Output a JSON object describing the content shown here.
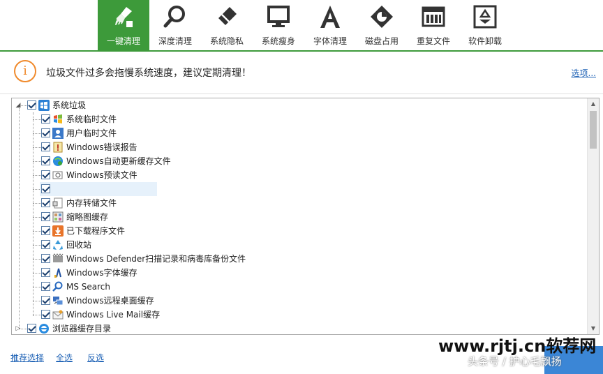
{
  "toolbar": {
    "tabs": [
      {
        "label": "一键清理",
        "icon": "broom-icon",
        "active": true
      },
      {
        "label": "深度清理",
        "icon": "magnifier-icon",
        "active": false
      },
      {
        "label": "系统隐私",
        "icon": "eraser-icon",
        "active": false
      },
      {
        "label": "系统瘦身",
        "icon": "monitor-icon",
        "active": false
      },
      {
        "label": "字体清理",
        "icon": "letter-a-icon",
        "active": false
      },
      {
        "label": "磁盘占用",
        "icon": "disk-pie-icon",
        "active": false
      },
      {
        "label": "重复文件",
        "icon": "duplicate-files-icon",
        "active": false
      },
      {
        "label": "软件卸载",
        "icon": "recycle-box-icon",
        "active": false
      }
    ],
    "accent": "#3d9a3a"
  },
  "info": {
    "icon": "info-warning-icon",
    "icon_glyph": "i",
    "message": "垃圾文件过多会拖慢系统速度，建议定期清理！",
    "options_link": "选项..."
  },
  "tree": {
    "root": {
      "label": "系统垃圾",
      "icon": "windows-logo-icon",
      "checked": true,
      "expanded": true
    },
    "items": [
      {
        "label": "系统临时文件",
        "icon": "windows-flag-icon",
        "checked": true
      },
      {
        "label": "用户临时文件",
        "icon": "user-icon",
        "checked": true
      },
      {
        "label": "Windows错误报告",
        "icon": "error-report-icon",
        "checked": true
      },
      {
        "label": "Windows自动更新缓存文件",
        "icon": "windows-update-icon",
        "checked": true
      },
      {
        "label": "Windows预读文件",
        "icon": "prefetch-icon",
        "checked": true
      },
      {
        "label": "",
        "icon": "",
        "checked": true,
        "selected": true
      },
      {
        "label": "内存转储文件",
        "icon": "memory-dump-icon",
        "checked": true
      },
      {
        "label": "缩略图缓存",
        "icon": "thumbnail-icon",
        "checked": true
      },
      {
        "label": "已下载程序文件",
        "icon": "download-icon",
        "checked": true
      },
      {
        "label": "回收站",
        "icon": "recycle-bin-icon",
        "checked": true
      },
      {
        "label": "Windows Defender扫描记录和病毒库备份文件",
        "icon": "defender-icon",
        "checked": true
      },
      {
        "label": "Windows字体缓存",
        "icon": "font-cache-icon",
        "checked": true
      },
      {
        "label": "MS Search",
        "icon": "search-icon",
        "checked": true
      },
      {
        "label": "Windows远程桌面缓存",
        "icon": "remote-desktop-icon",
        "checked": true
      },
      {
        "label": "Windows Live Mail缓存",
        "icon": "live-mail-icon",
        "checked": true
      }
    ],
    "second_root": {
      "label": "浏览器缓存目录",
      "icon": "ie-icon",
      "checked": true,
      "expanded": false
    }
  },
  "footer": {
    "recommend": "推荐选择",
    "select_all": "全选",
    "invert": "反选"
  },
  "watermark": {
    "site": "www.rjtj.cn软荐网",
    "credit": "头条号 / 护心毛飘扬"
  }
}
